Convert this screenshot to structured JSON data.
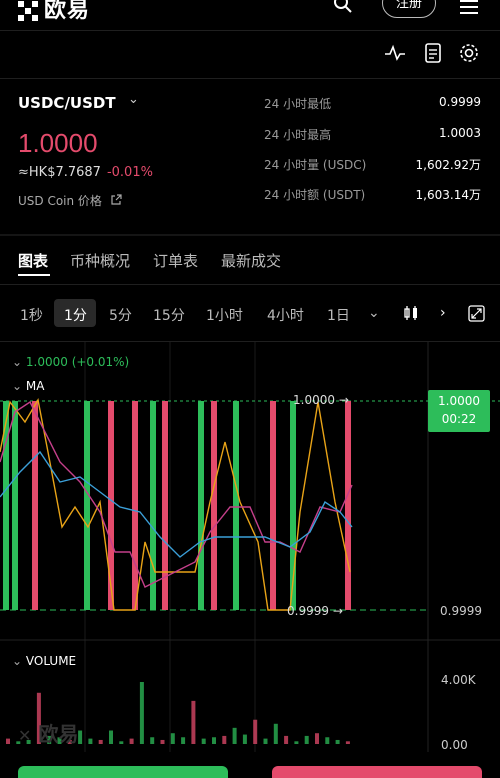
{
  "header": {
    "logo_text": "欧易",
    "register_label": "注册"
  },
  "ticker": {
    "pair": "USDC/USDT",
    "last_price": "1.0000",
    "fiat_price": "≈HK$7.7687",
    "change_pct": "-0.01%",
    "coin_link": "USD Coin 价格",
    "stats": [
      {
        "label": "24 小时最低",
        "value": "0.9999"
      },
      {
        "label": "24 小时最高",
        "value": "1.0003"
      },
      {
        "label": "24 小时量 (USDC)",
        "value": "1,602.92万"
      },
      {
        "label": "24 小时额 (USDT)",
        "value": "1,603.14万"
      }
    ]
  },
  "tabs": [
    "图表",
    "币种概况",
    "订单表",
    "最新成交"
  ],
  "intervals": [
    "1秒",
    "1分",
    "5分",
    "15分",
    "1小时",
    "4小时",
    "1日"
  ],
  "chart": {
    "indicator_price": "1.0000 (+0.01%)",
    "ma_label": "MA",
    "high_label": "1.0000",
    "low_label": "0.9999",
    "axis_price_top": "0.9999",
    "current_price_tag": "1.0000",
    "countdown": "00:22",
    "volume_label": "VOLUME",
    "volume_ticks": [
      "4.00K",
      "0.00"
    ],
    "watermark": "欧易"
  },
  "colors": {
    "up": "#2dbd5a",
    "down": "#e44b6c",
    "ma1": "#e8a317",
    "ma2": "#c43f8a",
    "ma3": "#3b9fd8"
  },
  "chart_data": {
    "type": "bar",
    "candles": [
      {
        "dir": "up",
        "y": 1.0,
        "lo": 0.9999
      },
      {
        "dir": "up",
        "y": 1.0,
        "lo": 0.9999
      },
      {
        "dir": "down",
        "y": 1.0,
        "lo": 0.9999
      },
      {
        "dir": "up",
        "y": 1.0,
        "lo": 0.9999
      },
      {
        "dir": "down",
        "y": 1.0,
        "lo": 0.9999
      },
      {
        "dir": "down",
        "y": 1.0,
        "lo": 0.9999
      },
      {
        "dir": "up",
        "y": 1.0,
        "lo": 0.9999
      },
      {
        "dir": "down",
        "y": 1.0,
        "lo": 0.9999
      },
      {
        "dir": "up",
        "y": 1.0,
        "lo": 0.9999
      },
      {
        "dir": "down",
        "y": 1.0,
        "lo": 0.9999
      },
      {
        "dir": "up",
        "y": 1.0,
        "lo": 0.9999
      },
      {
        "dir": "down",
        "y": 1.0,
        "lo": 0.9999
      },
      {
        "dir": "up",
        "y": 1.0,
        "lo": 0.9999
      },
      {
        "dir": "down",
        "y": 1.0,
        "lo": 0.9999
      }
    ],
    "volume": [
      0.4,
      0.2,
      0.3,
      3.8,
      0.6,
      0.5,
      0.3,
      1.0,
      0.4,
      0.3,
      1.0,
      0.2,
      0.4,
      4.6,
      0.5,
      0.3,
      0.8,
      0.5,
      3.2,
      0.4,
      0.5,
      0.6,
      1.2,
      0.7,
      1.8,
      0.4,
      1.5,
      0.6,
      0.2,
      0.6,
      0.8,
      0.5,
      0.3,
      0.2
    ],
    "ylim": [
      0.9999,
      1.0
    ],
    "volume_ylim": [
      0,
      4000
    ]
  }
}
